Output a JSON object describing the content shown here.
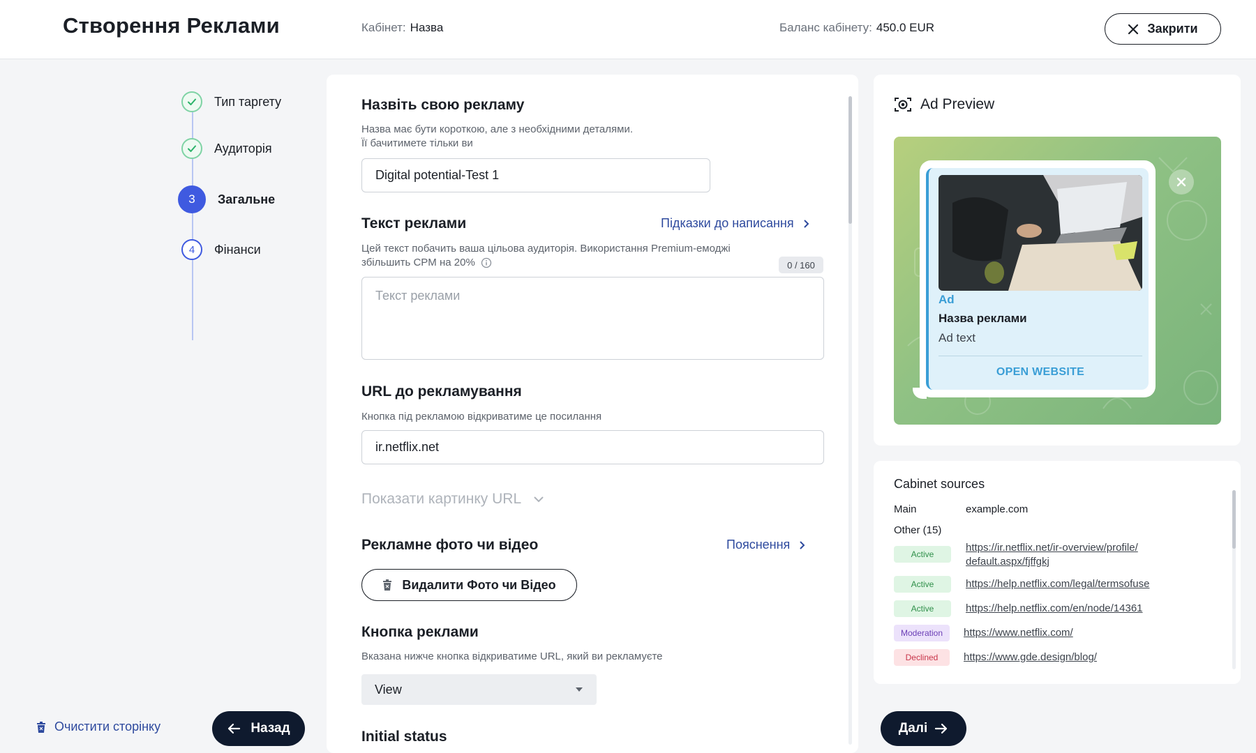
{
  "header": {
    "title": "Створення Реклами",
    "cabinet_label": "Кабінет:",
    "cabinet_value": "Назва",
    "balance_label": "Баланс кабінету:",
    "balance_value": "450.0 EUR",
    "close_label": "Закрити"
  },
  "steps": [
    {
      "label": "Тип таргету",
      "state": "done"
    },
    {
      "label": "Аудиторія",
      "state": "done"
    },
    {
      "label": "Загальне",
      "state": "active",
      "number": "3"
    },
    {
      "label": "Фінанси",
      "state": "pending",
      "number": "4"
    }
  ],
  "footer": {
    "clear_label": "Очистити сторінку",
    "back_label": "Назад",
    "next_label": "Далі"
  },
  "form": {
    "name": {
      "heading": "Назвіть свою рекламу",
      "hint_line1": "Назва має бути короткою, але з необхідними деталями.",
      "hint_line2": "Її бачитимете тільки ви",
      "value": "Digital potential-Test 1"
    },
    "text": {
      "heading": "Текст реклами",
      "tips_link": "Підказки до написання",
      "hint_line1": "Цей текст побачить ваша цільова аудиторія. Використання Premium-емоджі",
      "hint_line2": "збільшить CPM на 20%",
      "counter": "0 / 160",
      "placeholder": "Текст реклами"
    },
    "url": {
      "heading": "URL до рекламування",
      "hint": "Кнопка під рекламою відкриватиме це посилання",
      "value": "ir.netflix.net"
    },
    "show_url_image": "Показати картинку URL",
    "media": {
      "heading": "Рекламне фото чи відео",
      "explain_link": "Пояснення",
      "delete_label": "Видалити Фото чи Відео"
    },
    "button": {
      "heading": "Кнопка реклами",
      "hint": "Вказана нижче кнопка відкриватиме URL, який ви рекламуєте",
      "selected": "View"
    },
    "initial_status_heading": "Initial status"
  },
  "preview": {
    "title": "Ad Preview",
    "ad_label": "Ad",
    "ad_name": "Назва реклами",
    "ad_text": "Ad text",
    "open_button": "OPEN WEBSITE"
  },
  "sources": {
    "title": "Cabinet sources",
    "main_label": "Main",
    "main_value": "example.com",
    "other_label": "Other (15)",
    "items": [
      {
        "status": "Active",
        "url_line1": "https://ir.netflix.net/ir-overview/profile/",
        "url_line2": "default.aspx/fjffgkj"
      },
      {
        "status": "Active",
        "url_line1": "https://help.netflix.com/legal/termsofuse"
      },
      {
        "status": "Active",
        "url_line1": "https://help.netflix.com/en/node/14361"
      },
      {
        "status": "Moderation",
        "url_line1": "https://www.netflix.com/"
      },
      {
        "status": "Declined",
        "url_line1": "https://www.gde.design/blog/"
      }
    ]
  },
  "colors": {
    "accent": "#3f5ae0",
    "link": "#2e4a9e",
    "dark_button": "#0f1a2e",
    "telegram_blue": "#3a9ed6"
  }
}
